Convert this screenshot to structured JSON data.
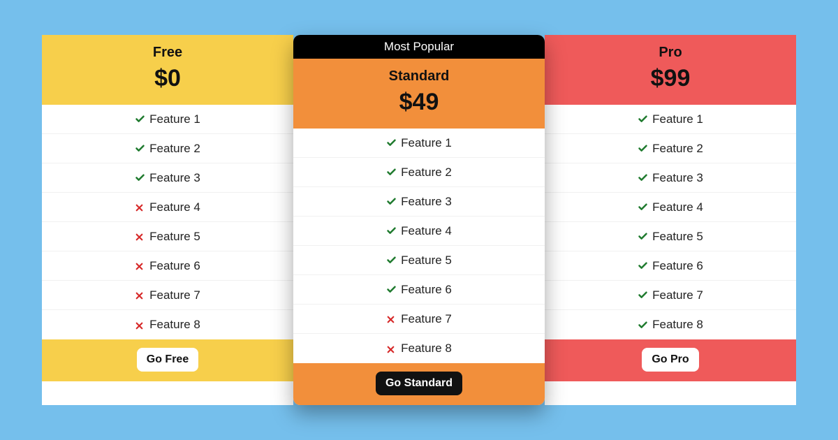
{
  "ribbon": "Most Popular",
  "icons": {
    "check": {
      "color": "#1f7a2e"
    },
    "cross": {
      "color": "#d72a2a"
    }
  },
  "plans": [
    {
      "key": "free",
      "name": "Free",
      "price": "$0",
      "accent": "#f7cf4b",
      "popular": false,
      "cta": "Go Free",
      "ctaStyle": "light",
      "features": [
        {
          "label": "Feature 1",
          "included": true
        },
        {
          "label": "Feature 2",
          "included": true
        },
        {
          "label": "Feature 3",
          "included": true
        },
        {
          "label": "Feature 4",
          "included": false
        },
        {
          "label": "Feature 5",
          "included": false
        },
        {
          "label": "Feature 6",
          "included": false
        },
        {
          "label": "Feature 7",
          "included": false
        },
        {
          "label": "Feature 8",
          "included": false
        }
      ]
    },
    {
      "key": "standard",
      "name": "Standard",
      "price": "$49",
      "accent": "#f28f3b",
      "popular": true,
      "cta": "Go Standard",
      "ctaStyle": "dark",
      "features": [
        {
          "label": "Feature 1",
          "included": true
        },
        {
          "label": "Feature 2",
          "included": true
        },
        {
          "label": "Feature 3",
          "included": true
        },
        {
          "label": "Feature 4",
          "included": true
        },
        {
          "label": "Feature 5",
          "included": true
        },
        {
          "label": "Feature 6",
          "included": true
        },
        {
          "label": "Feature 7",
          "included": false
        },
        {
          "label": "Feature 8",
          "included": false
        }
      ]
    },
    {
      "key": "pro",
      "name": "Pro",
      "price": "$99",
      "accent": "#ef5a5a",
      "popular": false,
      "cta": "Go Pro",
      "ctaStyle": "light",
      "features": [
        {
          "label": "Feature 1",
          "included": true
        },
        {
          "label": "Feature 2",
          "included": true
        },
        {
          "label": "Feature 3",
          "included": true
        },
        {
          "label": "Feature 4",
          "included": true
        },
        {
          "label": "Feature 5",
          "included": true
        },
        {
          "label": "Feature 6",
          "included": true
        },
        {
          "label": "Feature 7",
          "included": true
        },
        {
          "label": "Feature 8",
          "included": true
        }
      ]
    }
  ]
}
